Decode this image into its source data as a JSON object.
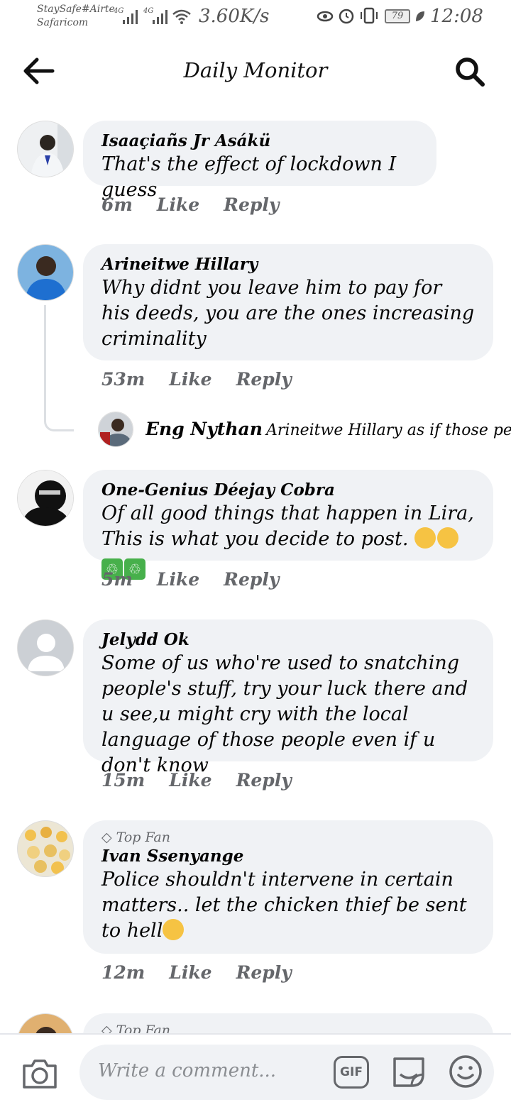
{
  "status_bar": {
    "carrier_1": "StaySafe#Airtel",
    "carrier_2": "Safaricom",
    "sig_1": "4G",
    "sig_2": "4G",
    "speed": "3.60K/s",
    "battery": "79",
    "time": "12:08"
  },
  "header": {
    "title": "Daily Monitor"
  },
  "comments": [
    {
      "author": "Isaaçiañs Jr Asákü",
      "text": "That's the effect of lockdown I guess",
      "time": "6m",
      "like": "Like",
      "reply": "Reply"
    },
    {
      "author": "Arineitwe Hillary",
      "text": "Why didnt you leave him to pay for his deeds, you are the ones increasing criminality",
      "time": "53m",
      "like": "Like",
      "reply": "Reply",
      "reply_preview": {
        "author": "Eng Nythan",
        "text": "Arineitwe Hillary as if those people..."
      }
    },
    {
      "author": "One-Genius Déejay Cobra",
      "text": "Of all good things that happen in Lira, This is what you decide to post.",
      "time": "5m",
      "like": "Like",
      "reply": "Reply"
    },
    {
      "author": "Jelydd Ok",
      "text": "Some of us who're used to snatching people's stuff, try your luck there and u see,u might cry with the local language of those people even if u don't know",
      "time": "15m",
      "like": "Like",
      "reply": "Reply"
    },
    {
      "badge": "Top Fan",
      "author": "Ivan Ssenyange",
      "text": "Police shouldn't intervene in certain matters..  let the chicken thief be sent to hell",
      "time": "12m",
      "like": "Like",
      "reply": "Reply"
    },
    {
      "badge": "Top Fan"
    }
  ],
  "composer": {
    "placeholder": "Write a comment...",
    "gif_label": "GIF"
  },
  "colors": {
    "bubble": "#f0f2f5",
    "meta": "#65676b",
    "text": "#050505"
  }
}
